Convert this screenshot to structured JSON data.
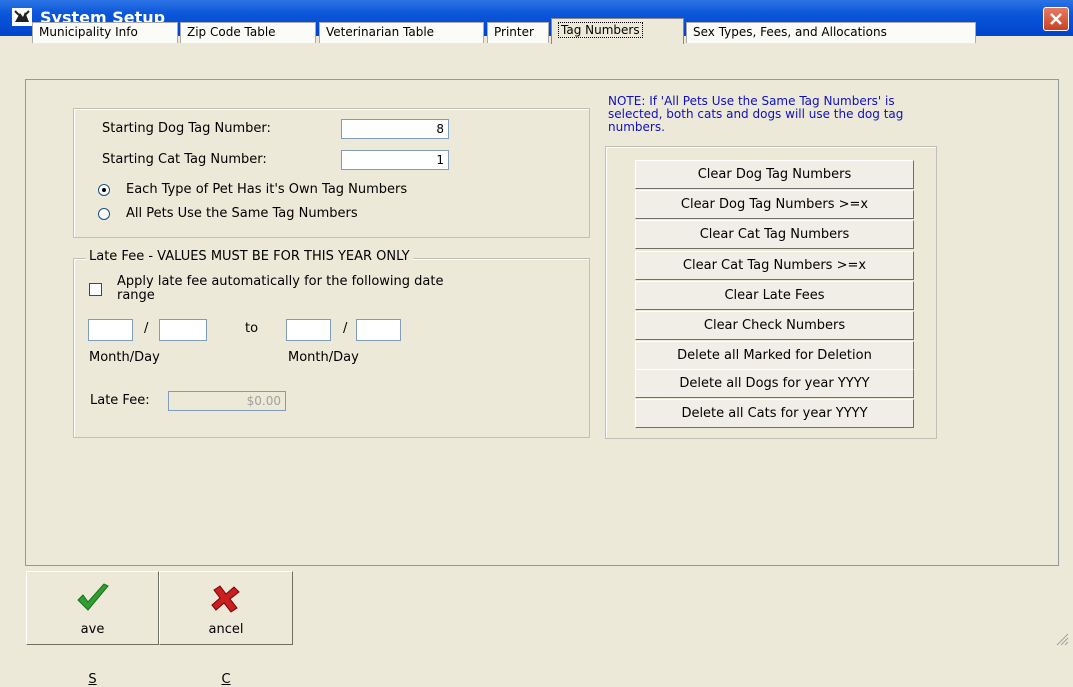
{
  "window": {
    "title": "System Setup"
  },
  "tabs": [
    {
      "label": "Municipality Info"
    },
    {
      "label": "Zip Code Table"
    },
    {
      "label": "Veterinarian Table"
    },
    {
      "label": "Printer"
    },
    {
      "label": "Tag Numbers",
      "active": true
    },
    {
      "label": "Sex Types, Fees, and Allocations"
    }
  ],
  "tag_numbers": {
    "dog_label": "Starting Dog Tag Number:",
    "dog_value": "8",
    "cat_label": "Starting Cat Tag Number:",
    "cat_value": "1",
    "option_own": "Each Type of Pet Has it's Own Tag Numbers",
    "option_same": "All Pets Use the Same Tag Numbers",
    "selected_option": "Each Type of Pet Has it's Own Tag Numbers"
  },
  "late_fee": {
    "legend": "Late Fee - VALUES MUST BE FOR THIS YEAR ONLY",
    "apply_label_line1": "Apply late fee automatically for the following date",
    "apply_label_line2": "range",
    "apply_checked": false,
    "separator": "/",
    "to_label": "to",
    "from_caption": "Month/Day",
    "to_caption": "Month/Day",
    "from_month": "",
    "from_day": "",
    "to_month": "",
    "to_day": "",
    "fee_label": "Late Fee:",
    "fee_value": "$0.00"
  },
  "note": {
    "line1": "NOTE: If 'All Pets Use the Same Tag Numbers' is",
    "line2": "selected, both cats and dogs will use the dog tag",
    "line3": "numbers."
  },
  "actions": [
    "Clear Dog Tag Numbers",
    "Clear Dog Tag Numbers >=x",
    "Clear Cat Tag Numbers",
    "Clear Cat Tag Numbers >=x",
    "Clear Late Fees",
    "Clear Check Numbers",
    "Delete all Marked for Deletion",
    "Delete all Dogs for year YYYY",
    "Delete all Cats for year YYYY"
  ],
  "footer": {
    "save_label": "Save",
    "save_icon": "checkmark-icon",
    "cancel_label": "Cancel",
    "cancel_icon": "x-icon"
  },
  "colors": {
    "title_bar": "#0a55d9",
    "note_text": "#1010c0",
    "save_icon": "#2fa02f",
    "cancel_icon": "#c82020"
  }
}
